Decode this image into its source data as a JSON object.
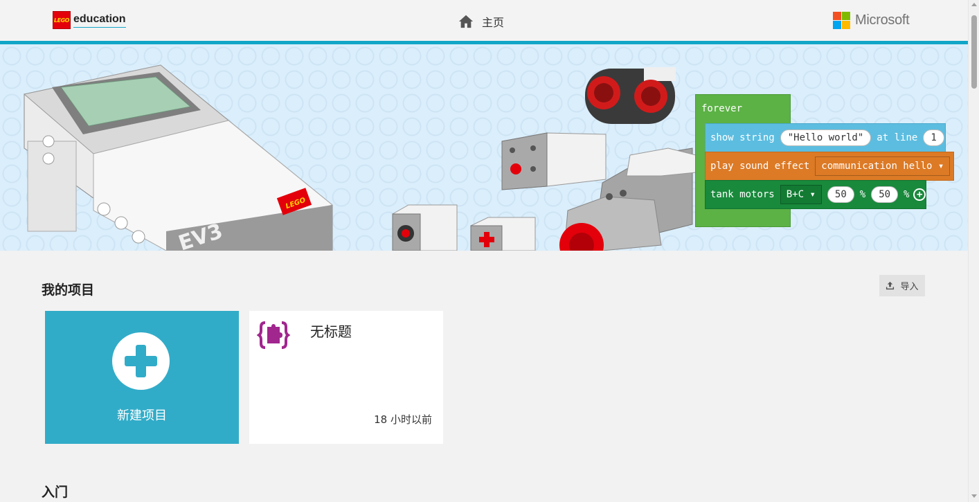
{
  "header": {
    "lego_badge_text": "LEGO",
    "education_text": "education",
    "home_icon": "home-icon",
    "home_label": "主页",
    "microsoft_text": "Microsoft",
    "microsoft_colors": [
      "#f25022",
      "#7fba00",
      "#00a4ef",
      "#ffb900"
    ],
    "accent_color": "#11a6c7"
  },
  "hero": {
    "brick_text": "EV3",
    "brick_logo_text": "LEGO",
    "forever_label": "forever",
    "show_string": {
      "keyword": "show string",
      "value": "\"Hello world\"",
      "at_line_label": "at line",
      "line_value": "1"
    },
    "play_sound": {
      "keyword": "play sound effect",
      "value": "communication hello"
    },
    "tank_motors": {
      "keyword": "tank motors",
      "ports": "B+C",
      "left_speed": "50",
      "left_unit": "%",
      "right_speed": "50",
      "right_unit": "%"
    }
  },
  "my_projects": {
    "title": "我的项目",
    "import_label": "导入",
    "import_icon": "upload-icon",
    "new_project_label": "新建项目",
    "projects": [
      {
        "title": "无标题",
        "time": "18 小时以前",
        "icon": "puzzle-icon"
      }
    ]
  },
  "getting_started": {
    "title": "入门"
  }
}
